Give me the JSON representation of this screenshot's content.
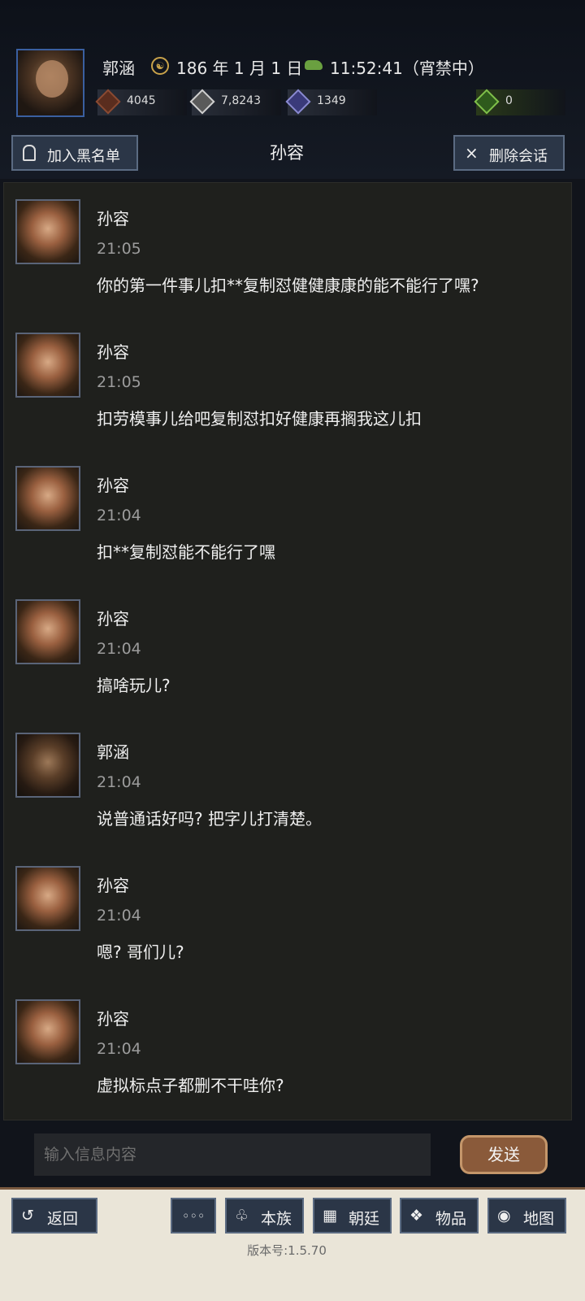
{
  "header": {
    "player_name": "郭涵",
    "date_icon_glyph": "☯",
    "date": "186 年 1 月 1 日",
    "time": "11:52:41（宵禁中）",
    "resources": [
      {
        "icon": "coin-icon",
        "value": "4045"
      },
      {
        "icon": "grain-icon",
        "value": "7,8243"
      },
      {
        "icon": "soldier-icon",
        "value": "1349"
      },
      {
        "icon": "gourd-icon",
        "value": "0"
      }
    ]
  },
  "toolbar": {
    "blacklist_label": "加入黑名单",
    "chat_title": "孙容",
    "delete_icon_glyph": "×",
    "delete_label": "删除会话"
  },
  "messages": [
    {
      "avatar": "female",
      "name": "孙容",
      "time": "21:05",
      "text": "你的第一件事儿扣**复制怼健健康康的能不能行了嘿?"
    },
    {
      "avatar": "female",
      "name": "孙容",
      "time": "21:05",
      "text": "扣劳模事儿给吧复制怼扣好健康再搁我这儿扣"
    },
    {
      "avatar": "female",
      "name": "孙容",
      "time": "21:04",
      "text": "扣**复制怼能不能行了嘿"
    },
    {
      "avatar": "female",
      "name": "孙容",
      "time": "21:04",
      "text": "搞啥玩儿?"
    },
    {
      "avatar": "male",
      "name": "郭涵",
      "time": "21:04",
      "text": "说普通话好吗? 把字儿打清楚。"
    },
    {
      "avatar": "female",
      "name": "孙容",
      "time": "21:04",
      "text": "嗯? 哥们儿?"
    },
    {
      "avatar": "female",
      "name": "孙容",
      "time": "21:04",
      "text": "虚拟标点子都删不干哇你?"
    }
  ],
  "composer": {
    "placeholder": "输入信息内容",
    "value": "",
    "send_label": "发送"
  },
  "bottom_nav": {
    "back_icon": "↺",
    "back_label": "返回",
    "more_label": "◦◦◦",
    "clan_icon": "♧",
    "clan_label": "本族",
    "court_icon": "▦",
    "court_label": "朝廷",
    "items_icon": "❖",
    "items_label": "物品",
    "map_icon": "◉",
    "map_label": "地图"
  },
  "version": "版本号:1.5.70"
}
